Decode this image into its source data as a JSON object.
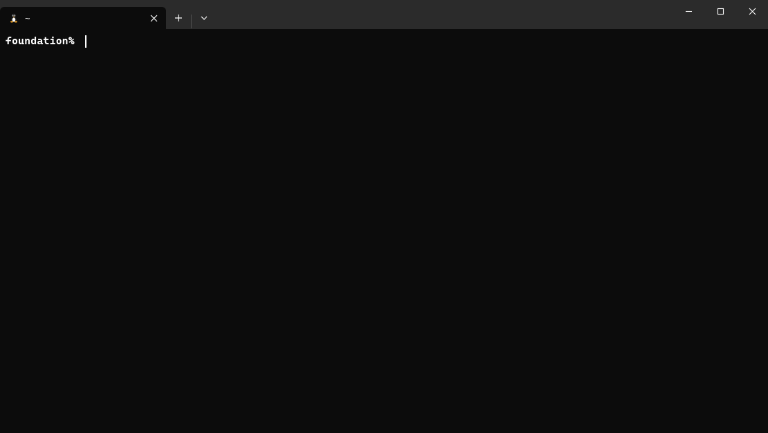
{
  "tab": {
    "title": "~",
    "icon": "tux-icon"
  },
  "terminal": {
    "prompt": "foundation% "
  }
}
